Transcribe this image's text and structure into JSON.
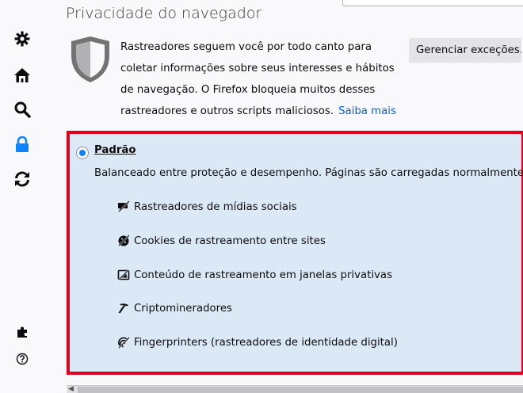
{
  "sidebar": {
    "items": [
      {
        "icon": "gear-icon"
      },
      {
        "icon": "home-icon"
      },
      {
        "icon": "search-icon"
      },
      {
        "icon": "lock-icon",
        "active": true
      },
      {
        "icon": "sync-icon"
      },
      {
        "icon": "extensions-icon"
      },
      {
        "icon": "help-icon"
      }
    ],
    "active_color": "#0a84ff"
  },
  "header": {
    "title": "Privacidade do navegador"
  },
  "tracking": {
    "description": "Rastreadores seguem você por todo canto para coletar informações sobre seus interesses e hábitos de navegação. O Firefox bloqueia muitos desses rastreadores e outros scripts maliciosos.",
    "learn_more": "Saiba mais",
    "manage_button": "Gerenciar exceções..."
  },
  "standard": {
    "label": "Padrão",
    "description": "Balanceado entre proteção e desempenho. Páginas são carregadas normalmente.",
    "selected": true,
    "highlight_color": "#e0001b",
    "background_color": "#dbe8f6",
    "features": [
      {
        "icon": "social-tracker-icon",
        "label": "Rastreadores de mídias sociais"
      },
      {
        "icon": "cookie-icon",
        "label": "Cookies de rastreamento entre sites"
      },
      {
        "icon": "tracking-content-icon",
        "label": "Conteúdo de rastreamento em janelas privativas"
      },
      {
        "icon": "cryptominer-icon",
        "label": "Criptomineradores"
      },
      {
        "icon": "fingerprinter-icon",
        "label": "Fingerprinters (rastreadores de identidade digital)"
      }
    ]
  }
}
